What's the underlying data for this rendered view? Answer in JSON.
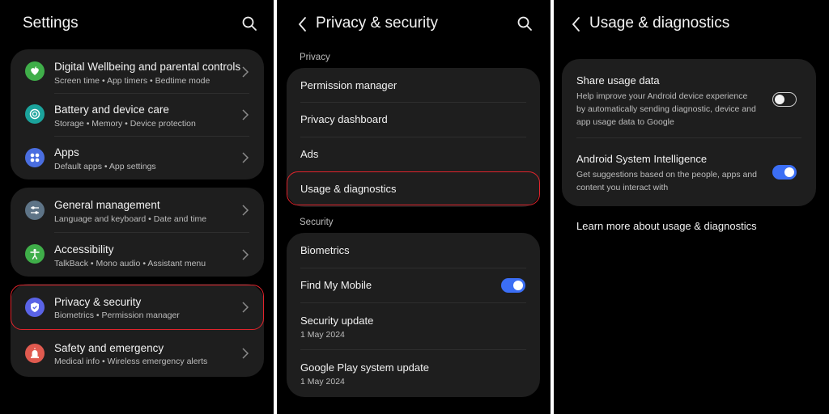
{
  "settings": {
    "title": "Settings",
    "group1": [
      {
        "title": "Digital Wellbeing and parental controls",
        "sub": "Screen time  •  App timers  •  Bedtime mode",
        "icon": "heart-leaf-icon",
        "color": "#3fae49"
      },
      {
        "title": "Battery and device care",
        "sub": "Storage  •  Memory  •  Device protection",
        "icon": "device-care-icon",
        "color": "#1ba39c"
      },
      {
        "title": "Apps",
        "sub": "Default apps  •  App settings",
        "icon": "apps-grid-icon",
        "color": "#4a6ee0"
      }
    ],
    "group2": [
      {
        "title": "General management",
        "sub": "Language and keyboard  •  Date and time",
        "icon": "sliders-icon",
        "color": "#5e7487"
      },
      {
        "title": "Accessibility",
        "sub": "TalkBack  •  Mono audio  •  Assistant menu",
        "icon": "accessibility-icon",
        "color": "#3fae49"
      }
    ],
    "group3": [
      {
        "title": "Privacy & security",
        "sub": "Biometrics  •  Permission manager",
        "icon": "shield-icon",
        "color": "#5a63e6"
      },
      {
        "title": "Safety and emergency",
        "sub": "Medical info  •  Wireless emergency alerts",
        "icon": "siren-icon",
        "color": "#e05a4f"
      }
    ]
  },
  "privacy": {
    "title": "Privacy & security",
    "section_privacy": "Privacy",
    "privacy_items": [
      "Permission manager",
      "Privacy dashboard",
      "Ads",
      "Usage & diagnostics"
    ],
    "section_security": "Security",
    "security_items": [
      {
        "title": "Biometrics",
        "sub": ""
      },
      {
        "title": "Find My Mobile",
        "sub": "",
        "toggle": "on"
      },
      {
        "title": "Security update",
        "sub": "1 May 2024"
      },
      {
        "title": "Google Play system update",
        "sub": "1 May 2024"
      }
    ]
  },
  "usage": {
    "title": "Usage & diagnostics",
    "items": [
      {
        "title": "Share usage data",
        "desc": "Help improve your Android device experience by automatically sending diagnostic, device and app usage data to Google",
        "toggle": "off"
      },
      {
        "title": "Android System Intelligence",
        "desc": "Get suggestions based on the people, apps and content you interact with",
        "toggle": "on"
      }
    ],
    "learn_more": "Learn more about usage & diagnostics"
  },
  "colors": {
    "accent": "#3b6ef5",
    "highlight": "#e0242c",
    "card": "#1e1e1e"
  }
}
